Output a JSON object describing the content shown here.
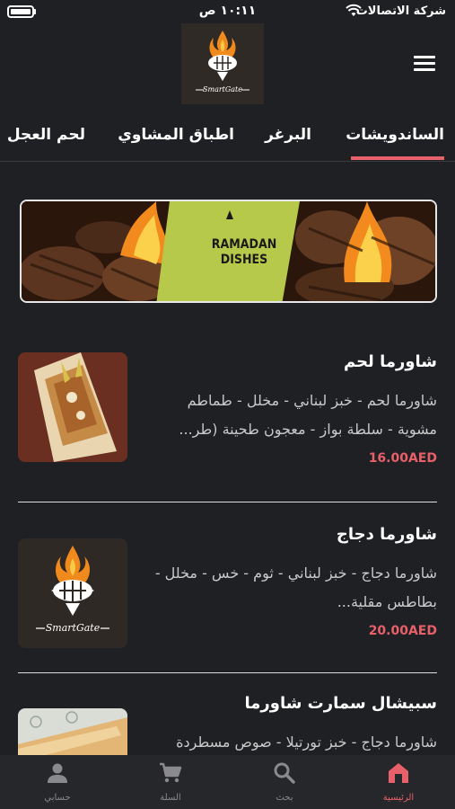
{
  "status_bar": {
    "time": "١٠:١١ ص",
    "carrier": "شركة الاتصالات"
  },
  "header": {
    "logo_text": "SmartGate"
  },
  "tabs": [
    {
      "label": "الساندويشات",
      "active": true
    },
    {
      "label": "البرغر",
      "active": false
    },
    {
      "label": "اطباق المشاوي",
      "active": false
    },
    {
      "label": "لحم العجل",
      "active": false
    }
  ],
  "banner": {
    "line1": "RAMADAN",
    "line2": "DISHES"
  },
  "products": [
    {
      "name": "شاورما لحم",
      "description": "شاورما لحم - خبز لبناني - مخلل - طماطم مشوية - سلطة بواز - معجون طحينة (طر...",
      "price": "16.00AED",
      "image": "shawarma-wrap"
    },
    {
      "name": "شاورما دجاج",
      "description": "شاورما دجاج - خبز لبناني - ثوم - خس - مخلل - بطاطس مقلية...",
      "price": "20.00AED",
      "image": "smartgate-logo"
    },
    {
      "name": "سبيشال سمارت شاورما",
      "description": "شاورما دجاج - خبز تورتيلا - صوص مسطردة",
      "price": "",
      "image": "tortilla-wrap"
    }
  ],
  "bottom_nav": [
    {
      "label": "الرئيسية",
      "icon": "home-icon",
      "active": true
    },
    {
      "label": "بحث",
      "icon": "search-icon",
      "active": false
    },
    {
      "label": "السلة",
      "icon": "cart-icon",
      "active": false
    },
    {
      "label": "حسابي",
      "icon": "person-icon",
      "active": false
    }
  ],
  "colors": {
    "background": "#1f2024",
    "accent": "#e8606a",
    "nav_background": "#26272b"
  }
}
